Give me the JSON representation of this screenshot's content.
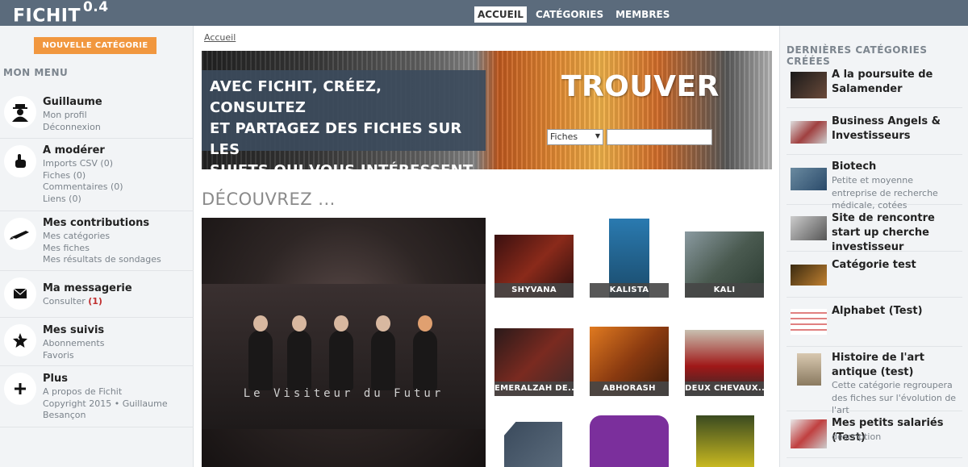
{
  "app": {
    "name": "FICHIT",
    "version": "0.4"
  },
  "nav": {
    "tabs": [
      "ACCUEIL",
      "CATÉGORIES",
      "MEMBRES"
    ]
  },
  "left": {
    "new_category": "NOUVELLE CATÉGORIE",
    "menu_title": "MON MENU",
    "sections": [
      {
        "title": "Guillaume",
        "links": [
          "Mon profil",
          "Déconnexion"
        ],
        "icon": "user-silhouette-icon"
      },
      {
        "title": "A modérer",
        "links": [
          "Imports CSV (0)",
          "Fiches (0)",
          "Commentaires (0)",
          "Liens (0)"
        ],
        "icon": "pointing-hand-icon"
      },
      {
        "title": "Mes contributions",
        "links": [
          "Mes catégories",
          "Mes fiches",
          "Mes résultats de sondages"
        ],
        "icon": "pen-icon"
      },
      {
        "title": "Ma messagerie",
        "link_prefix": "Consulter ",
        "link_count": "(1)",
        "icon": "envelope-icon"
      },
      {
        "title": "Mes suivis",
        "links": [
          "Abonnements",
          "Favoris"
        ],
        "icon": "star-icon"
      },
      {
        "title": "Plus",
        "links": [
          "A propos de Fichit",
          "Copyright 2015 • Guillaume",
          "Besançon"
        ],
        "icon": "plus-icon"
      }
    ]
  },
  "center": {
    "breadcrumb": "Accueil",
    "banner": {
      "line1_prefix": "AVEC ",
      "line1_brand": "FICHIT",
      "line1_suffix": ", CRÉEZ, CONSULTEZ",
      "line2": "ET PARTAGEZ DES FICHES SUR LES",
      "line3": "SUJETS QUI VOUS INTÉRESSENT !",
      "search_heading": "TROUVER",
      "search_type": "Fiches",
      "search_value": ""
    },
    "discover_title": "DÉCOUVREZ ...",
    "featured_caption": "Le Visiteur du Futur",
    "thumbs": [
      "SHYVANA",
      "KALISTA",
      "KALI",
      "EMERALZAH DE...",
      "ABHORASH",
      "DEUX CHEVAUX..."
    ]
  },
  "right": {
    "title": "DERNIÈRES CATÉGORIES CRÉÉES",
    "categories": [
      {
        "title": "A la poursuite de Salamender",
        "desc": ""
      },
      {
        "title": "Business Angels & Investisseurs",
        "desc": ""
      },
      {
        "title": "Biotech",
        "desc": "Petite et moyenne entreprise de recherche médicale, cotées"
      },
      {
        "title": "Site de rencontre start up cherche investisseur",
        "desc": ""
      },
      {
        "title": "Catégorie test",
        "desc": ""
      },
      {
        "title": "Alphabet (Test)",
        "desc": ""
      },
      {
        "title": "Histoire de l'art antique (test)",
        "desc": "Cette catégorie regroupera des fiches sur l'évolution de l'art"
      },
      {
        "title": "Mes petits salariés (Test)",
        "desc": "description"
      }
    ]
  },
  "colors": {
    "topbar": "#5b6b7c",
    "accent": "#f1973f",
    "sidebar_bg": "#f2f4f6",
    "alert": "#c03030"
  }
}
